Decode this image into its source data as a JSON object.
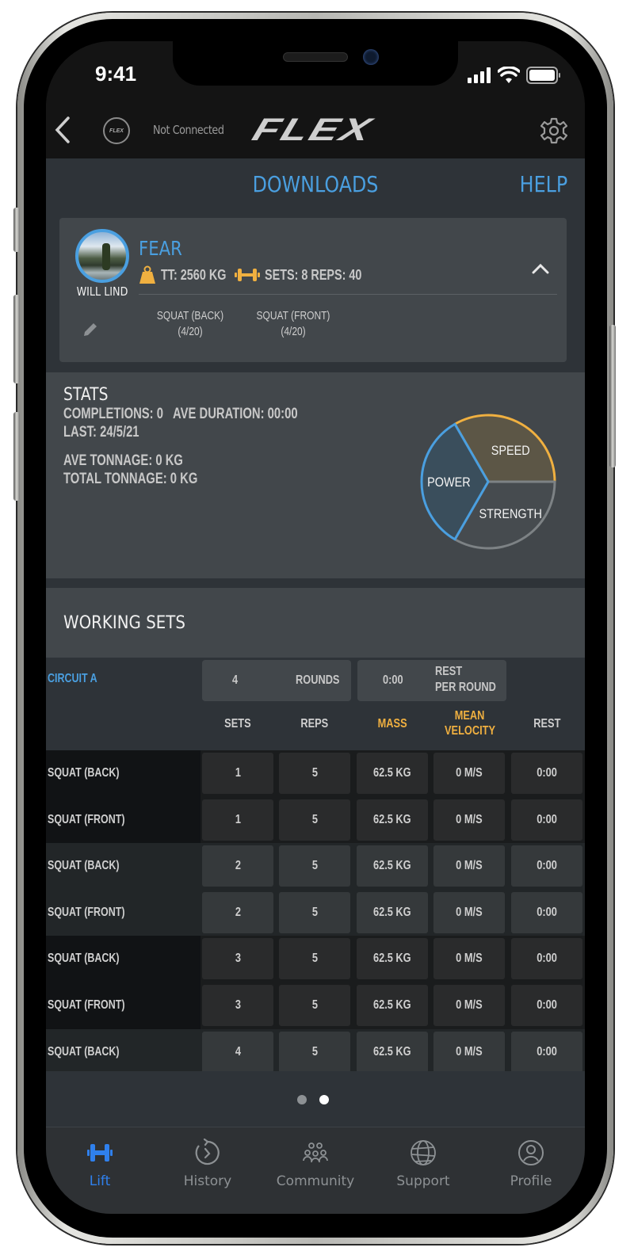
{
  "status_bar": {
    "time": "9:41"
  },
  "navbar": {
    "connection_status": "Not Connected",
    "device_logo_text": "FLEX",
    "brand": "FLEX"
  },
  "header": {
    "title": "DOWNLOADS",
    "help_label": "HELP"
  },
  "workout_card": {
    "athlete_name": "WILL LIND",
    "workout_name": "FEAR",
    "total_tonnage": "TT: 2560 KG",
    "sets_reps": "SETS: 8 REPS: 40",
    "exercises": [
      {
        "name": "SQUAT (BACK)",
        "progress": "(4/20)"
      },
      {
        "name": "SQUAT (FRONT)",
        "progress": "(4/20)"
      }
    ]
  },
  "stats": {
    "title": "STATS",
    "completions": "COMPLETIONS: 0",
    "ave_duration": "AVE DURATION: 00:00",
    "last": "LAST: 24/5/21",
    "ave_tonnage": "AVE TONNAGE: 0 KG",
    "total_tonnage": "TOTAL TONNAGE: 0 KG",
    "pie": {
      "segments": [
        {
          "label": "SPEED",
          "share": 0.333,
          "fill": "#5c5646",
          "stroke": "#f0b040"
        },
        {
          "label": "STRENGTH",
          "share": 0.333,
          "fill": "#464b4f",
          "stroke": "#7d8285"
        },
        {
          "label": "POWER",
          "share": 0.333,
          "fill": "#3a4e5c",
          "stroke": "#4a9fe0"
        }
      ]
    }
  },
  "working_sets": {
    "title": "WORKING SETS",
    "circuit": {
      "label": "CIRCUIT A",
      "rounds_value": "4",
      "rounds_label": "ROUNDS",
      "rest_value": "0:00",
      "rest_label_1": "REST",
      "rest_label_2": "PER ROUND"
    },
    "columns": [
      {
        "label": "SETS",
        "highlight": false
      },
      {
        "label": "REPS",
        "highlight": false
      },
      {
        "label": "MASS",
        "highlight": true
      },
      {
        "label": "MEAN VELOCITY",
        "highlight": true
      },
      {
        "label": "REST",
        "highlight": false
      }
    ],
    "rows": [
      {
        "exercise": "SQUAT (BACK)",
        "sets": "1",
        "reps": "5",
        "mass": "62.5 KG",
        "velocity": "0 M/S",
        "rest": "0:00"
      },
      {
        "exercise": "SQUAT (FRONT)",
        "sets": "1",
        "reps": "5",
        "mass": "62.5 KG",
        "velocity": "0 M/S",
        "rest": "0:00"
      },
      {
        "exercise": "SQUAT (BACK)",
        "sets": "2",
        "reps": "5",
        "mass": "62.5 KG",
        "velocity": "0 M/S",
        "rest": "0:00"
      },
      {
        "exercise": "SQUAT (FRONT)",
        "sets": "2",
        "reps": "5",
        "mass": "62.5 KG",
        "velocity": "0 M/S",
        "rest": "0:00"
      },
      {
        "exercise": "SQUAT (BACK)",
        "sets": "3",
        "reps": "5",
        "mass": "62.5 KG",
        "velocity": "0 M/S",
        "rest": "0:00"
      },
      {
        "exercise": "SQUAT (FRONT)",
        "sets": "3",
        "reps": "5",
        "mass": "62.5 KG",
        "velocity": "0 M/S",
        "rest": "0:00"
      },
      {
        "exercise": "SQUAT (BACK)",
        "sets": "4",
        "reps": "5",
        "mass": "62.5 KG",
        "velocity": "0 M/S",
        "rest": "0:00"
      }
    ]
  },
  "pager": {
    "page_count": 2,
    "active_page": 2
  },
  "tabbar": {
    "tabs": [
      {
        "label": "Lift",
        "icon": "dumbbell-icon",
        "active": true
      },
      {
        "label": "History",
        "icon": "history-icon",
        "active": false
      },
      {
        "label": "Community",
        "icon": "community-icon",
        "active": false
      },
      {
        "label": "Support",
        "icon": "globe-icon",
        "active": false
      },
      {
        "label": "Profile",
        "icon": "profile-icon",
        "active": false
      }
    ]
  },
  "colors": {
    "accent_blue": "#4a9fe0",
    "accent_orange": "#f0b040",
    "tab_active": "#2f80ed"
  }
}
